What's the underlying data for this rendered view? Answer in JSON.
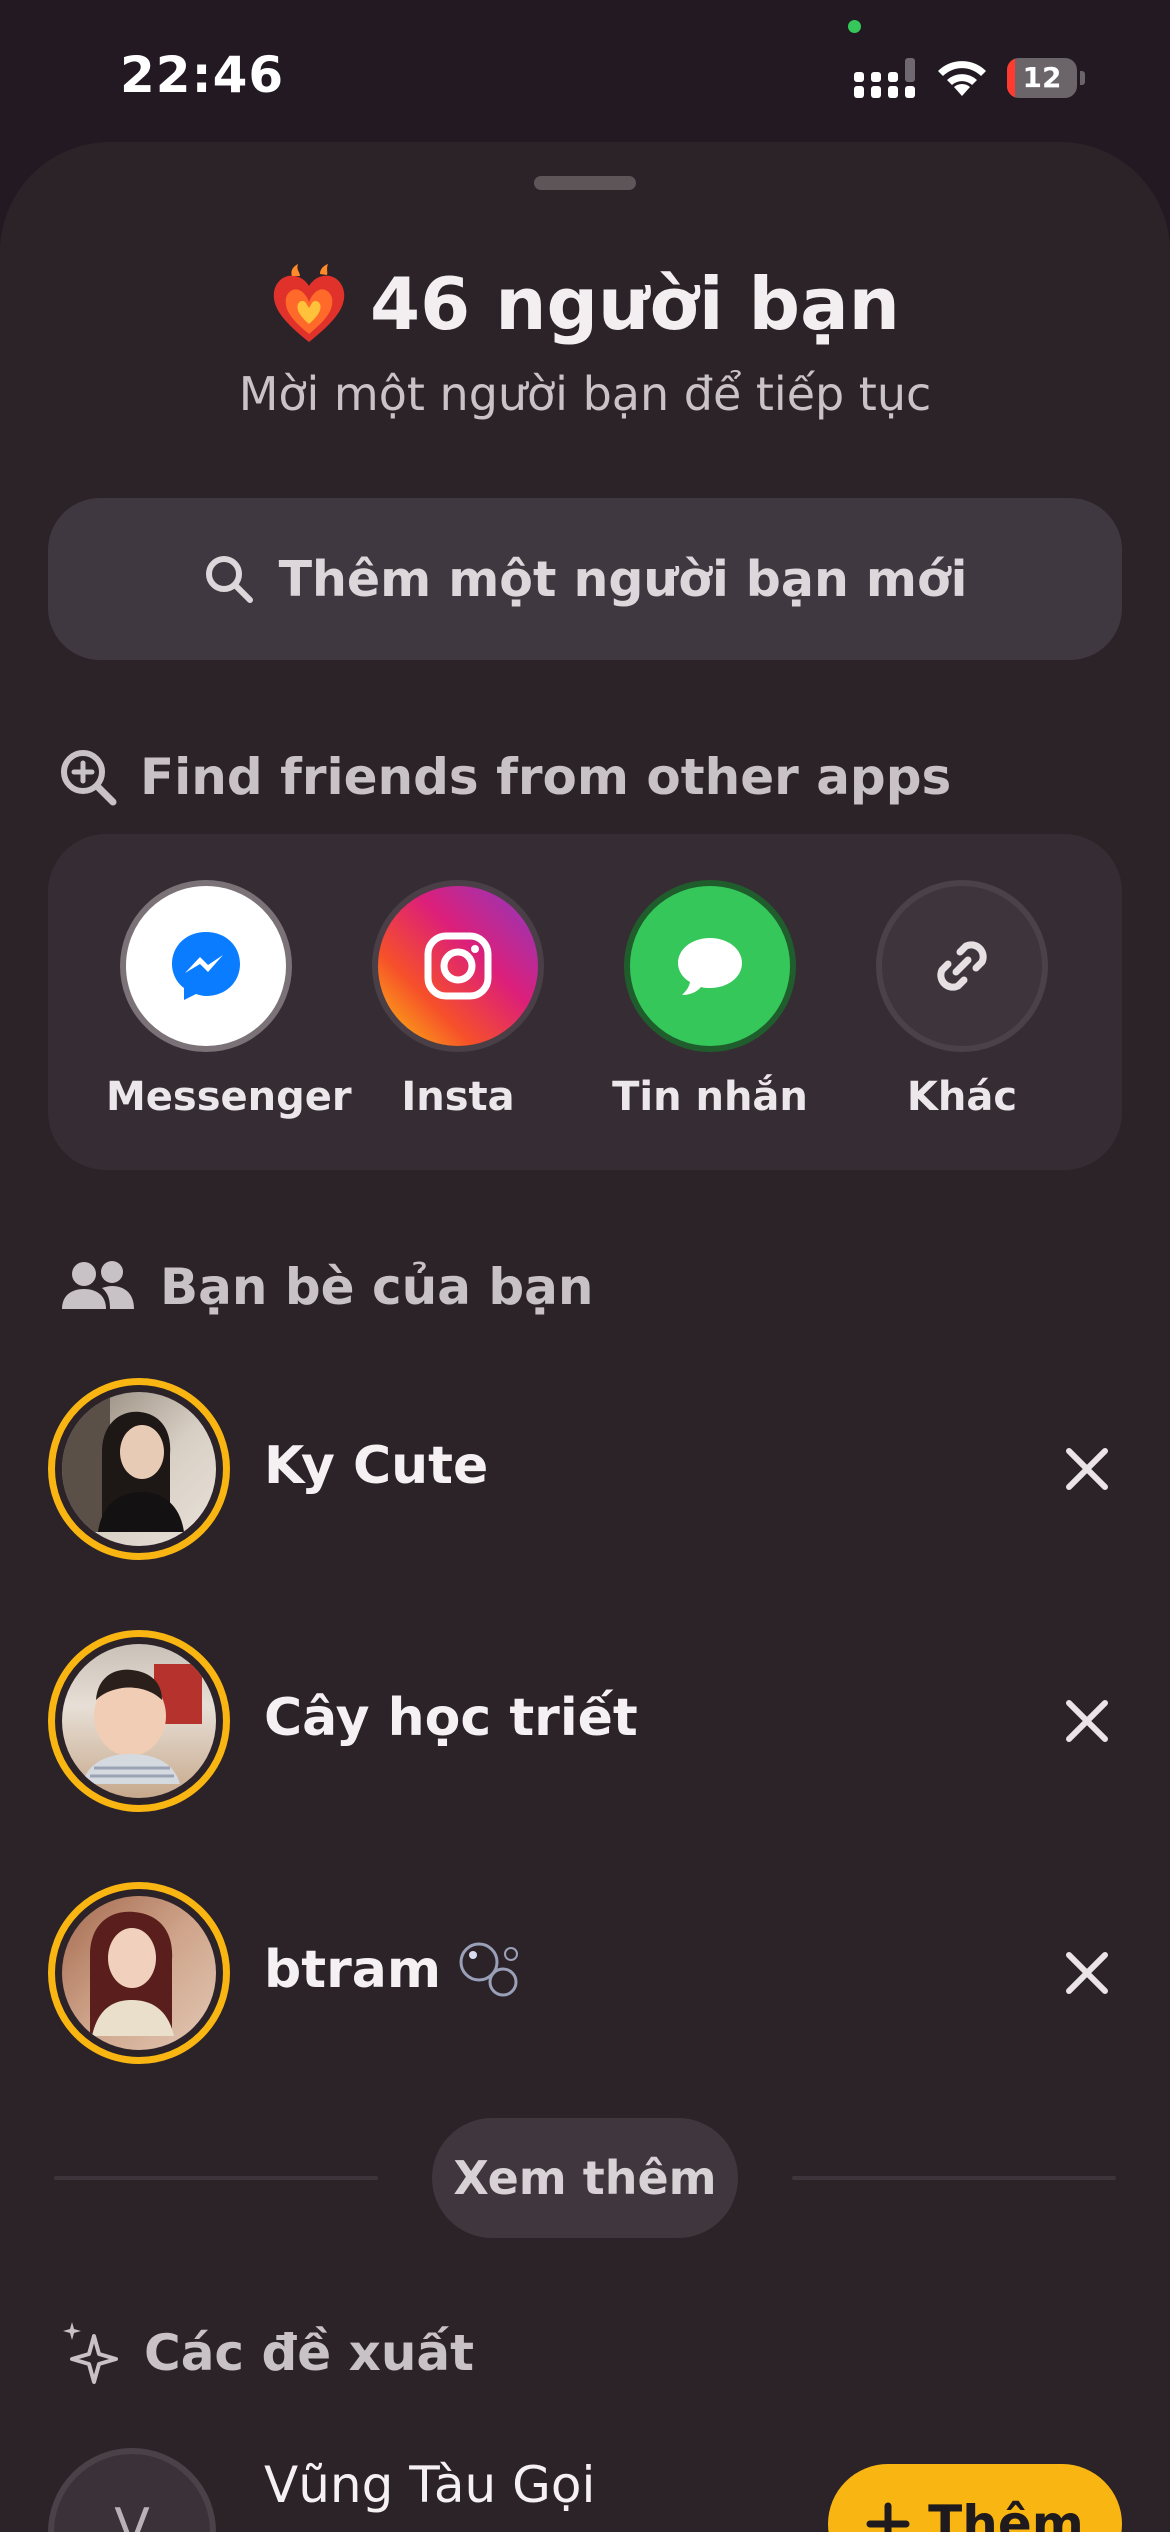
{
  "status_bar": {
    "time": "22:46",
    "battery_level": "12",
    "battery_fraction": 0.12,
    "signal_icon": "cellular-signal-icon",
    "wifi_icon": "wifi-icon"
  },
  "header": {
    "title": "46 người bạn",
    "subtitle": "Mời một người bạn để tiếp tục",
    "title_icon": "fire-heart-icon"
  },
  "search": {
    "placeholder": "Thêm một người bạn mới",
    "icon": "search-icon"
  },
  "find_friends": {
    "title": "Find friends from other apps",
    "icon": "search-plus-icon",
    "apps": [
      {
        "label": "Messenger",
        "icon": "messenger-icon"
      },
      {
        "label": "Insta",
        "icon": "instagram-icon"
      },
      {
        "label": "Tin nhắn",
        "icon": "messages-icon"
      },
      {
        "label": "Khác",
        "icon": "link-icon"
      }
    ]
  },
  "friends": {
    "title": "Bạn bè của bạn",
    "icon": "people-icon",
    "items": [
      {
        "name": "Ky Cute",
        "badge": ""
      },
      {
        "name": "Cây học triết",
        "badge": ""
      },
      {
        "name": "btram",
        "badge": "🫧"
      }
    ],
    "see_more": "Xem thêm"
  },
  "suggestions": {
    "title": "Các đề xuất",
    "icon": "sparkles-icon",
    "items": [
      {
        "name": "Vũng Tàu Gọi",
        "initial": "V",
        "add_label": "Thêm"
      }
    ]
  },
  "colors": {
    "background": "#221922",
    "sheet": "#2c2329",
    "accent": "#f9b612",
    "messenger_blue": "#0a7cff",
    "messages_green": "#35c759"
  }
}
